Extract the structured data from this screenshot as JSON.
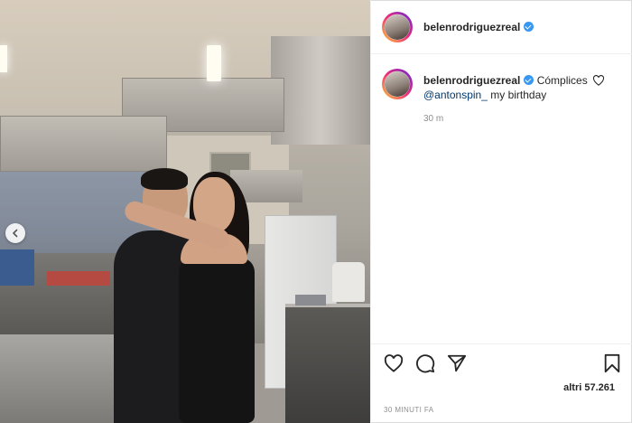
{
  "post": {
    "username": "belenrodriguezreal",
    "caption": {
      "username": "belenrodriguezreal",
      "text": "Cómplices",
      "mention": "@antonspin_",
      "text_after": " my birthday"
    },
    "caption_time": "30 m",
    "likes": "altri 57.261",
    "date": "30 MINUTI FA"
  },
  "icons": {
    "carousel_prev": "chevron-left-icon",
    "verified": "verified-badge-icon",
    "like": "heart-icon",
    "comment": "comment-icon",
    "share": "send-icon",
    "save": "bookmark-icon"
  },
  "colors": {
    "verified": "#3897f0",
    "mention": "#00376b",
    "muted": "#8e8e8e"
  }
}
